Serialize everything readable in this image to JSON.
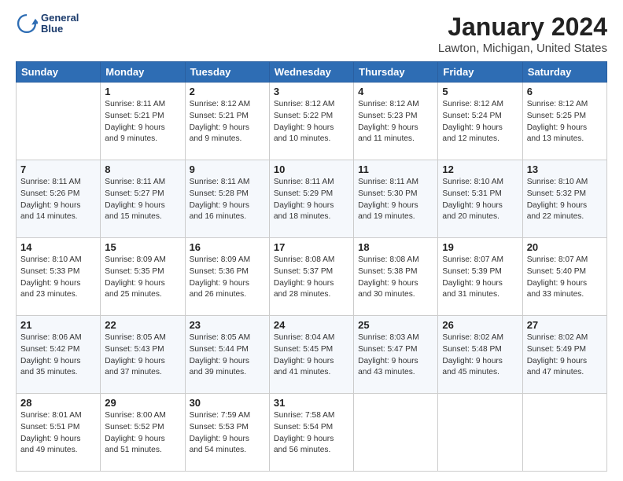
{
  "header": {
    "logo_line1": "General",
    "logo_line2": "Blue",
    "title": "January 2024",
    "subtitle": "Lawton, Michigan, United States"
  },
  "days_of_week": [
    "Sunday",
    "Monday",
    "Tuesday",
    "Wednesday",
    "Thursday",
    "Friday",
    "Saturday"
  ],
  "weeks": [
    [
      {
        "day": "",
        "info": ""
      },
      {
        "day": "1",
        "info": "Sunrise: 8:11 AM\nSunset: 5:21 PM\nDaylight: 9 hours\nand 9 minutes."
      },
      {
        "day": "2",
        "info": "Sunrise: 8:12 AM\nSunset: 5:21 PM\nDaylight: 9 hours\nand 9 minutes."
      },
      {
        "day": "3",
        "info": "Sunrise: 8:12 AM\nSunset: 5:22 PM\nDaylight: 9 hours\nand 10 minutes."
      },
      {
        "day": "4",
        "info": "Sunrise: 8:12 AM\nSunset: 5:23 PM\nDaylight: 9 hours\nand 11 minutes."
      },
      {
        "day": "5",
        "info": "Sunrise: 8:12 AM\nSunset: 5:24 PM\nDaylight: 9 hours\nand 12 minutes."
      },
      {
        "day": "6",
        "info": "Sunrise: 8:12 AM\nSunset: 5:25 PM\nDaylight: 9 hours\nand 13 minutes."
      }
    ],
    [
      {
        "day": "7",
        "info": "Sunrise: 8:11 AM\nSunset: 5:26 PM\nDaylight: 9 hours\nand 14 minutes."
      },
      {
        "day": "8",
        "info": "Sunrise: 8:11 AM\nSunset: 5:27 PM\nDaylight: 9 hours\nand 15 minutes."
      },
      {
        "day": "9",
        "info": "Sunrise: 8:11 AM\nSunset: 5:28 PM\nDaylight: 9 hours\nand 16 minutes."
      },
      {
        "day": "10",
        "info": "Sunrise: 8:11 AM\nSunset: 5:29 PM\nDaylight: 9 hours\nand 18 minutes."
      },
      {
        "day": "11",
        "info": "Sunrise: 8:11 AM\nSunset: 5:30 PM\nDaylight: 9 hours\nand 19 minutes."
      },
      {
        "day": "12",
        "info": "Sunrise: 8:10 AM\nSunset: 5:31 PM\nDaylight: 9 hours\nand 20 minutes."
      },
      {
        "day": "13",
        "info": "Sunrise: 8:10 AM\nSunset: 5:32 PM\nDaylight: 9 hours\nand 22 minutes."
      }
    ],
    [
      {
        "day": "14",
        "info": "Sunrise: 8:10 AM\nSunset: 5:33 PM\nDaylight: 9 hours\nand 23 minutes."
      },
      {
        "day": "15",
        "info": "Sunrise: 8:09 AM\nSunset: 5:35 PM\nDaylight: 9 hours\nand 25 minutes."
      },
      {
        "day": "16",
        "info": "Sunrise: 8:09 AM\nSunset: 5:36 PM\nDaylight: 9 hours\nand 26 minutes."
      },
      {
        "day": "17",
        "info": "Sunrise: 8:08 AM\nSunset: 5:37 PM\nDaylight: 9 hours\nand 28 minutes."
      },
      {
        "day": "18",
        "info": "Sunrise: 8:08 AM\nSunset: 5:38 PM\nDaylight: 9 hours\nand 30 minutes."
      },
      {
        "day": "19",
        "info": "Sunrise: 8:07 AM\nSunset: 5:39 PM\nDaylight: 9 hours\nand 31 minutes."
      },
      {
        "day": "20",
        "info": "Sunrise: 8:07 AM\nSunset: 5:40 PM\nDaylight: 9 hours\nand 33 minutes."
      }
    ],
    [
      {
        "day": "21",
        "info": "Sunrise: 8:06 AM\nSunset: 5:42 PM\nDaylight: 9 hours\nand 35 minutes."
      },
      {
        "day": "22",
        "info": "Sunrise: 8:05 AM\nSunset: 5:43 PM\nDaylight: 9 hours\nand 37 minutes."
      },
      {
        "day": "23",
        "info": "Sunrise: 8:05 AM\nSunset: 5:44 PM\nDaylight: 9 hours\nand 39 minutes."
      },
      {
        "day": "24",
        "info": "Sunrise: 8:04 AM\nSunset: 5:45 PM\nDaylight: 9 hours\nand 41 minutes."
      },
      {
        "day": "25",
        "info": "Sunrise: 8:03 AM\nSunset: 5:47 PM\nDaylight: 9 hours\nand 43 minutes."
      },
      {
        "day": "26",
        "info": "Sunrise: 8:02 AM\nSunset: 5:48 PM\nDaylight: 9 hours\nand 45 minutes."
      },
      {
        "day": "27",
        "info": "Sunrise: 8:02 AM\nSunset: 5:49 PM\nDaylight: 9 hours\nand 47 minutes."
      }
    ],
    [
      {
        "day": "28",
        "info": "Sunrise: 8:01 AM\nSunset: 5:51 PM\nDaylight: 9 hours\nand 49 minutes."
      },
      {
        "day": "29",
        "info": "Sunrise: 8:00 AM\nSunset: 5:52 PM\nDaylight: 9 hours\nand 51 minutes."
      },
      {
        "day": "30",
        "info": "Sunrise: 7:59 AM\nSunset: 5:53 PM\nDaylight: 9 hours\nand 54 minutes."
      },
      {
        "day": "31",
        "info": "Sunrise: 7:58 AM\nSunset: 5:54 PM\nDaylight: 9 hours\nand 56 minutes."
      },
      {
        "day": "",
        "info": ""
      },
      {
        "day": "",
        "info": ""
      },
      {
        "day": "",
        "info": ""
      }
    ]
  ]
}
